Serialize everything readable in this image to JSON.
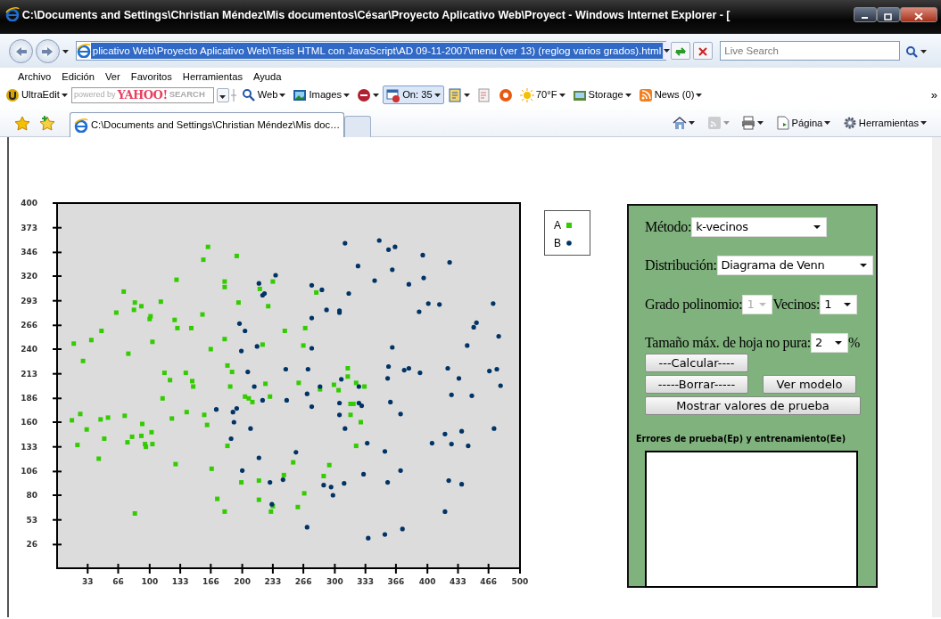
{
  "window": {
    "title": "C:\\Documents and Settings\\Christian Méndez\\Mis documentos\\César\\Proyecto Aplicativo Web\\Proyect - Windows Internet Explorer - ["
  },
  "address_bar": {
    "url": "plicativo Web\\Proyecto Aplicativo Web\\Tesis HTML con JavaScript\\AD 09-11-2007\\menu (ver 13) (reglog varios grados).html",
    "highlighted": true
  },
  "search": {
    "placeholder": "Live Search"
  },
  "menu": [
    "Archivo",
    "Edición",
    "Ver",
    "Favoritos",
    "Herramientas",
    "Ayuda"
  ],
  "yahoo_search": {
    "hint": "powered by",
    "logo": "YAHOO!",
    "button": "SEARCH"
  },
  "links_toolbar": [
    {
      "kind": "ultraedit",
      "label": "UltraEdit",
      "dropdown": true,
      "pressed": false
    },
    {
      "kind": "yahoo"
    },
    {
      "kind": "web",
      "label": "Web",
      "dropdown": true,
      "pressed": false
    },
    {
      "kind": "images",
      "label": "Images",
      "dropdown": true,
      "pressed": false
    },
    {
      "kind": "antispy",
      "dropdown": true,
      "pressed": false
    },
    {
      "kind": "popup",
      "label": "On: 35",
      "dropdown": true,
      "pressed": true
    },
    {
      "kind": "bookmark",
      "dropdown": true,
      "pressed": false
    },
    {
      "kind": "edit",
      "dropdown": false,
      "pressed": false
    },
    {
      "kind": "help",
      "dropdown": false,
      "pressed": false
    },
    {
      "kind": "weather",
      "label": "70°F",
      "dropdown": true,
      "pressed": false
    },
    {
      "kind": "storage",
      "label": "Storage",
      "dropdown": true,
      "pressed": false
    },
    {
      "kind": "news",
      "label": "News (0)",
      "dropdown": true,
      "pressed": false
    },
    {
      "kind": "more",
      "label": "»",
      "dropdown": false,
      "pressed": false
    }
  ],
  "tabs": [
    {
      "label": "C:\\Documents and Settings\\Christian Méndez\\Mis doc…",
      "selected": true
    }
  ],
  "command_bar": [
    {
      "kind": "home",
      "dropdown": true,
      "disabled": false
    },
    {
      "kind": "feeds",
      "dropdown": true,
      "disabled": true
    },
    {
      "kind": "print",
      "dropdown": true,
      "disabled": false
    },
    {
      "kind": "page",
      "label": "Página",
      "dropdown": true,
      "disabled": false
    },
    {
      "kind": "tools",
      "label": "Herramientas",
      "dropdown": true,
      "disabled": false
    }
  ],
  "chart": {
    "chart_data": {
      "type": "scatter",
      "xlim": [
        0,
        500
      ],
      "ylim": [
        0,
        400
      ],
      "xticks": [
        33,
        66,
        100,
        133,
        166,
        200,
        233,
        266,
        300,
        333,
        366,
        400,
        433,
        466,
        500
      ],
      "yticks": [
        26,
        53,
        80,
        106,
        133,
        160,
        186,
        213,
        240,
        266,
        293,
        320,
        346,
        373,
        400
      ],
      "series": [
        {
          "name": "A",
          "color": "#33cc00",
          "x": [
            18,
            28,
            37,
            48,
            64,
            72,
            84,
            91,
            83,
            77,
            100,
            101,
            103,
            112,
            129,
            127,
            130,
            145,
            157,
            158,
            163,
            166,
            181,
            181,
            196,
            194,
            181,
            184,
            189,
            187,
            116,
            122,
            139,
            146,
            147,
            114,
            140,
            124,
            159,
            162,
            16,
            25,
            32,
            22,
            47,
            55,
            51,
            45,
            73,
            76,
            81,
            91,
            92,
            95,
            96,
            102,
            103,
            128,
            167,
            184,
            199,
            218,
            218,
            173,
            181,
            84,
            233,
            219,
            228,
            222,
            225,
            230,
            203,
            207,
            211,
            246,
            245,
            255,
            261,
            266,
            268,
            267,
            260,
            231,
            233,
            280,
            284,
            299,
            304,
            314,
            314,
            323,
            332,
            317,
            320,
            317,
            328,
            323,
            294,
            288
          ],
          "values": [
            246,
            227,
            250,
            260,
            280,
            303,
            291,
            287,
            283,
            235,
            273,
            276,
            248,
            292,
            316,
            272,
            263,
            263,
            278,
            338,
            352,
            240,
            314,
            308,
            291,
            342,
            251,
            222,
            215,
            199,
            214,
            206,
            214,
            205,
            199,
            186,
            171,
            164,
            168,
            157,
            162,
            169,
            152,
            135,
            163,
            165,
            142,
            120,
            167,
            138,
            144,
            145,
            158,
            136,
            133,
            149,
            136,
            114,
            109,
            134,
            94,
            96,
            75,
            76,
            62,
            60,
            314,
            306,
            287,
            245,
            202,
            188,
            188,
            186,
            182,
            260,
            102,
            116,
            203,
            244,
            263,
            82,
            67,
            62,
            68,
            302,
            196,
            201,
            195,
            219,
            210,
            203,
            199,
            180,
            180,
            168,
            160,
            134,
            113,
            101
          ]
        },
        {
          "name": "B",
          "color": "#003366",
          "x": [
            236,
            218,
            222,
            224,
            197,
            203,
            199,
            216,
            206,
            213,
            222,
            172,
            190,
            194,
            191,
            209,
            188,
            218,
            258,
            200,
            230,
            244,
            232,
            270,
            247,
            248,
            271,
            270,
            275,
            286,
            275,
            275,
            275,
            311,
            348,
            358,
            365,
            325,
            362,
            343,
            315,
            291,
            305,
            305,
            395,
            424,
            396,
            380,
            401,
            413,
            391,
            471,
            453,
            450,
            477,
            443,
            362,
            358,
            357,
            375,
            380,
            392,
            422,
            434,
            467,
            475,
            479,
            426,
            448,
            307,
            284,
            326,
            305,
            326,
            329,
            305,
            360,
            371,
            311,
            335,
            354,
            405,
            419,
            426,
            437,
            444,
            472,
            331,
            371,
            357,
            310,
            288,
            296,
            298,
            423,
            437,
            419,
            336,
            354,
            373
          ],
          "values": [
            321,
            312,
            299,
            301,
            268,
            260,
            238,
            243,
            215,
            199,
            184,
            174,
            171,
            175,
            160,
            153,
            142,
            121,
            127,
            107,
            94,
            97,
            70,
            45,
            218,
            184,
            218,
            191,
            310,
            305,
            274,
            241,
            177,
            356,
            359,
            349,
            352,
            331,
            327,
            315,
            301,
            283,
            282,
            280,
            343,
            335,
            318,
            311,
            290,
            289,
            281,
            290,
            269,
            264,
            254,
            244,
            242,
            221,
            208,
            217,
            219,
            214,
            219,
            208,
            216,
            218,
            200,
            190,
            189,
            207,
            199,
            199,
            181,
            181,
            178,
            168,
            182,
            169,
            153,
            137,
            128,
            137,
            147,
            136,
            150,
            134,
            153,
            103,
            107,
            94,
            93,
            91,
            89,
            80,
            96,
            92,
            62,
            33,
            37,
            43
          ]
        }
      ]
    }
  },
  "panel": {
    "method": {
      "label": "Método:",
      "value": "k-vecinos",
      "disabled": false
    },
    "distribution": {
      "label": "Distribución:",
      "value": "Diagrama de Venn",
      "disabled": false
    },
    "degree": {
      "label": "Grado polinomio:",
      "value": "1",
      "disabled": true
    },
    "neighbors": {
      "label": "Vecinos:",
      "value": "1",
      "disabled": false
    },
    "leaf_size": {
      "label": "Tamaño máx. de hoja no pura:",
      "value": "2",
      "disabled": false,
      "suffix": "%"
    },
    "buttons": [
      "---Calcular----",
      "-----Borrar-----",
      "Ver modelo",
      "Mostrar valores de prueba"
    ],
    "errors_title": "Errores de prueba(Ep) y entrenamiento(Ee)"
  }
}
